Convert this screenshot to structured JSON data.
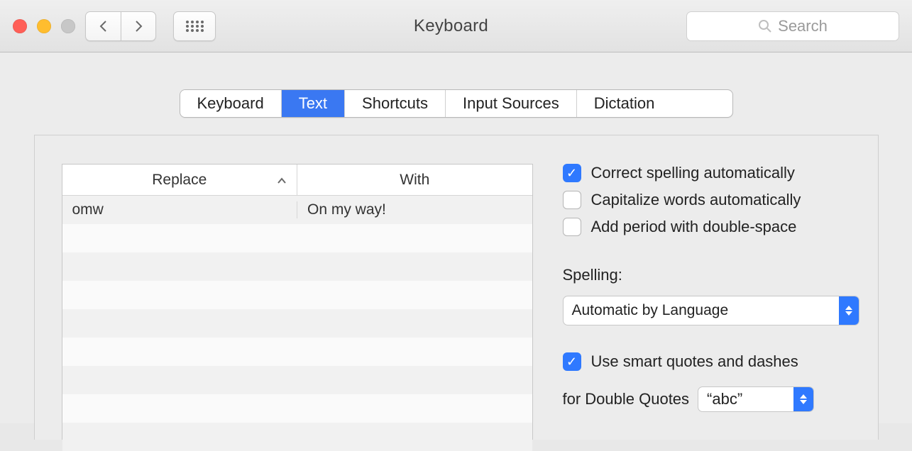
{
  "window": {
    "title": "Keyboard"
  },
  "toolbar": {
    "search_placeholder": "Search"
  },
  "tabs": [
    {
      "label": "Keyboard",
      "active": false
    },
    {
      "label": "Text",
      "active": true
    },
    {
      "label": "Shortcuts",
      "active": false
    },
    {
      "label": "Input Sources",
      "active": false
    },
    {
      "label": "Dictation",
      "active": false
    }
  ],
  "replace_table": {
    "headers": {
      "replace": "Replace",
      "with": "With"
    },
    "rows": [
      {
        "replace": "omw",
        "with": "On my way!"
      }
    ]
  },
  "options": {
    "correct_spelling": {
      "label": "Correct spelling automatically",
      "checked": true
    },
    "capitalize_words": {
      "label": "Capitalize words automatically",
      "checked": false
    },
    "add_period": {
      "label": "Add period with double-space",
      "checked": false
    },
    "spelling_label": "Spelling:",
    "spelling_value": "Automatic by Language",
    "smart_quotes": {
      "label": "Use smart quotes and dashes",
      "checked": true
    },
    "double_quotes_label": "for Double Quotes",
    "double_quotes_value": "“abc”"
  }
}
